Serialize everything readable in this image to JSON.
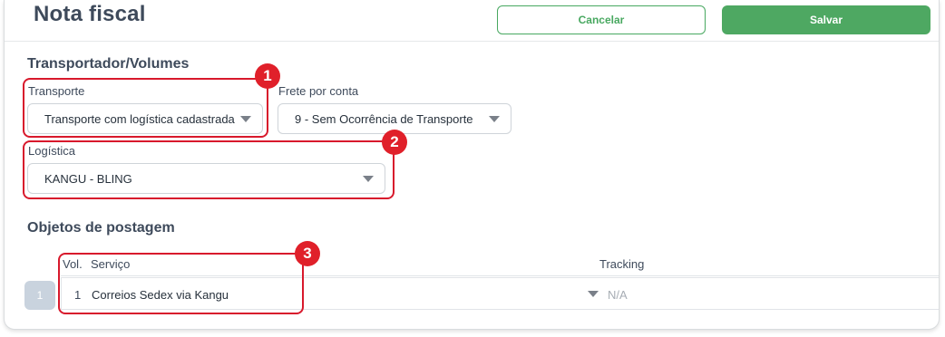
{
  "header": {
    "title": "Nota fiscal",
    "cancel_label": "Cancelar",
    "save_label": "Salvar"
  },
  "transport": {
    "section_title": "Transportador/Volumes",
    "transporte_label": "Transporte",
    "transporte_value": "Transporte com logística cadastrada",
    "frete_label": "Frete por conta",
    "frete_value": "9 - Sem Ocorrência de Transporte",
    "logistica_label": "Logística",
    "logistica_value": "KANGU - BLING"
  },
  "objetos": {
    "section_title": "Objetos de postagem",
    "columns": {
      "vol": "Vol.",
      "servico": "Serviço",
      "tracking": "Tracking"
    },
    "row_pill": "1",
    "rows": [
      {
        "vol": "1",
        "servico": "Correios Sedex via Kangu",
        "tracking": "N/A"
      }
    ]
  },
  "annotations": [
    "1",
    "2",
    "3"
  ],
  "colors": {
    "accent": "#4ea862",
    "highlight": "#d8192c",
    "text": "#3e4a5b"
  }
}
